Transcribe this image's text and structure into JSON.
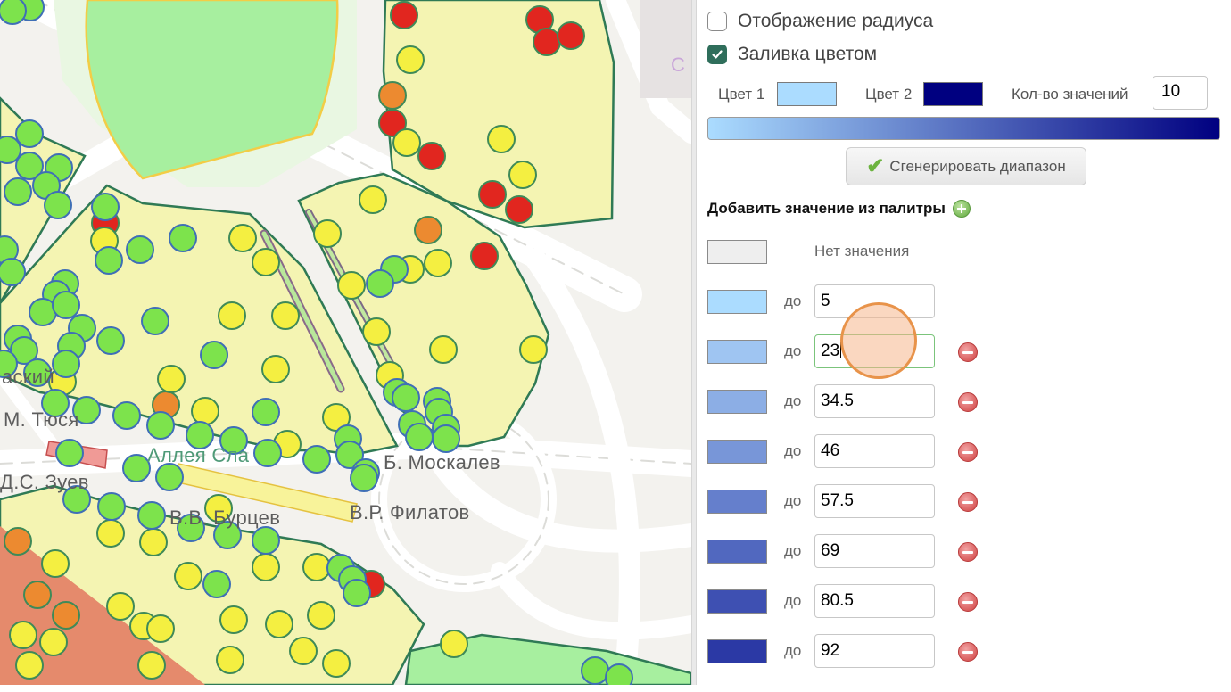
{
  "map": {
    "labels": {
      "skiy": "аский",
      "tyusya": "М. Тюся",
      "alley": "Аллея Сла",
      "moskalev": "Б. Москалев",
      "zuev": "Д.С. Зуев",
      "burtsev": "В.В. Бурцев",
      "filatov": "В.Р. Филатов",
      "corner": "С"
    },
    "colors": {
      "park_yellow": "#f4f4b2",
      "park_green": "#a7ef9f",
      "park_red": "#e58a6c",
      "outline": "#2f7a55",
      "tree_red": "#e1261f",
      "tree_orange": "#ec8a30",
      "tree_yellow": "#f4ef41",
      "tree_green": "#7de34c"
    }
  },
  "panel": {
    "show_radius_label": "Отображение радиуса",
    "show_radius_checked": false,
    "fill_color_label": "Заливка цветом",
    "fill_color_checked": true,
    "color1_label": "Цвет 1",
    "color1": "#abdcff",
    "color2_label": "Цвет 2",
    "color2": "#000080",
    "count_label": "Кол-во значений",
    "count_value": "10",
    "generate_label": "Сгенерировать диапазон",
    "palette_title": "Добавить значение из палитры",
    "no_value_label": "Нет значения",
    "no_value_color": "#eeeeee",
    "to_label": "до",
    "ranges": [
      {
        "value": "5",
        "color": "#abdcff",
        "removable": false,
        "active": false
      },
      {
        "value": "23",
        "color": "#9fc5f2",
        "removable": true,
        "active": true
      },
      {
        "value": "34.5",
        "color": "#8caee5",
        "removable": true,
        "active": false
      },
      {
        "value": "46",
        "color": "#7896d8",
        "removable": true,
        "active": false
      },
      {
        "value": "57.5",
        "color": "#657fcc",
        "removable": true,
        "active": false
      },
      {
        "value": "69",
        "color": "#5168bf",
        "removable": true,
        "active": false
      },
      {
        "value": "80.5",
        "color": "#3e50b2",
        "removable": true,
        "active": false
      },
      {
        "value": "92",
        "color": "#2b39a5",
        "removable": true,
        "active": false
      }
    ]
  }
}
